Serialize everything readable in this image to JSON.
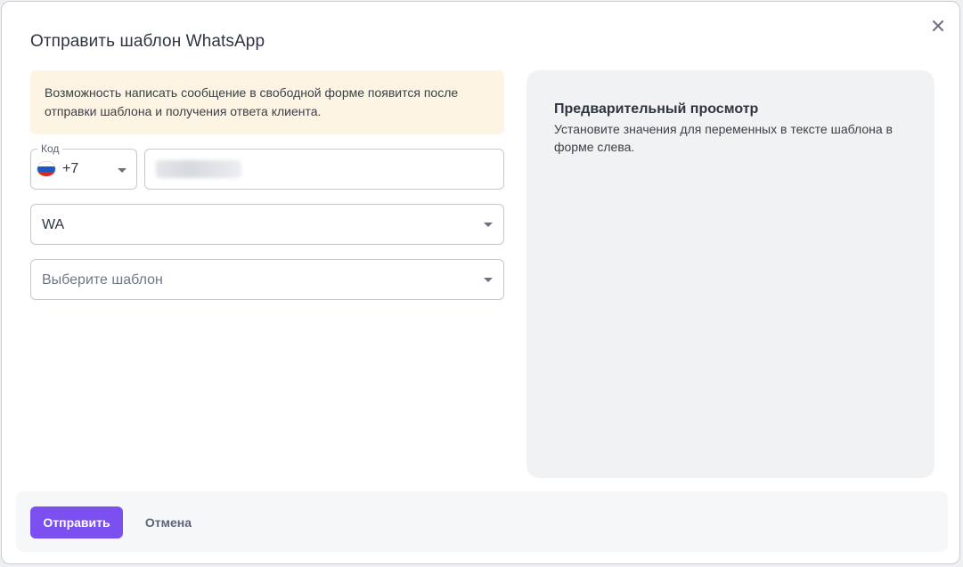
{
  "dialog": {
    "title": "Отправить шаблон WhatsApp",
    "close_icon": "close-icon"
  },
  "notice": {
    "text": "Возможность написать сообщение в свободной форме появится после отправки шаблона и получения ответа клиента."
  },
  "phone": {
    "code_label": "Код",
    "country_flag": "russia-flag-icon",
    "code_value": "+7"
  },
  "channel": {
    "value": "WA"
  },
  "template": {
    "placeholder": "Выберите шаблон"
  },
  "preview": {
    "title": "Предварительный просмотр",
    "text": "Установите значения для переменных в тексте шаблона в форме слева."
  },
  "footer": {
    "send_label": "Отправить",
    "cancel_label": "Отмена"
  },
  "colors": {
    "accent": "#7b4ff0",
    "notice_bg": "#fdf4e3",
    "preview_bg": "#f1f2f4"
  }
}
